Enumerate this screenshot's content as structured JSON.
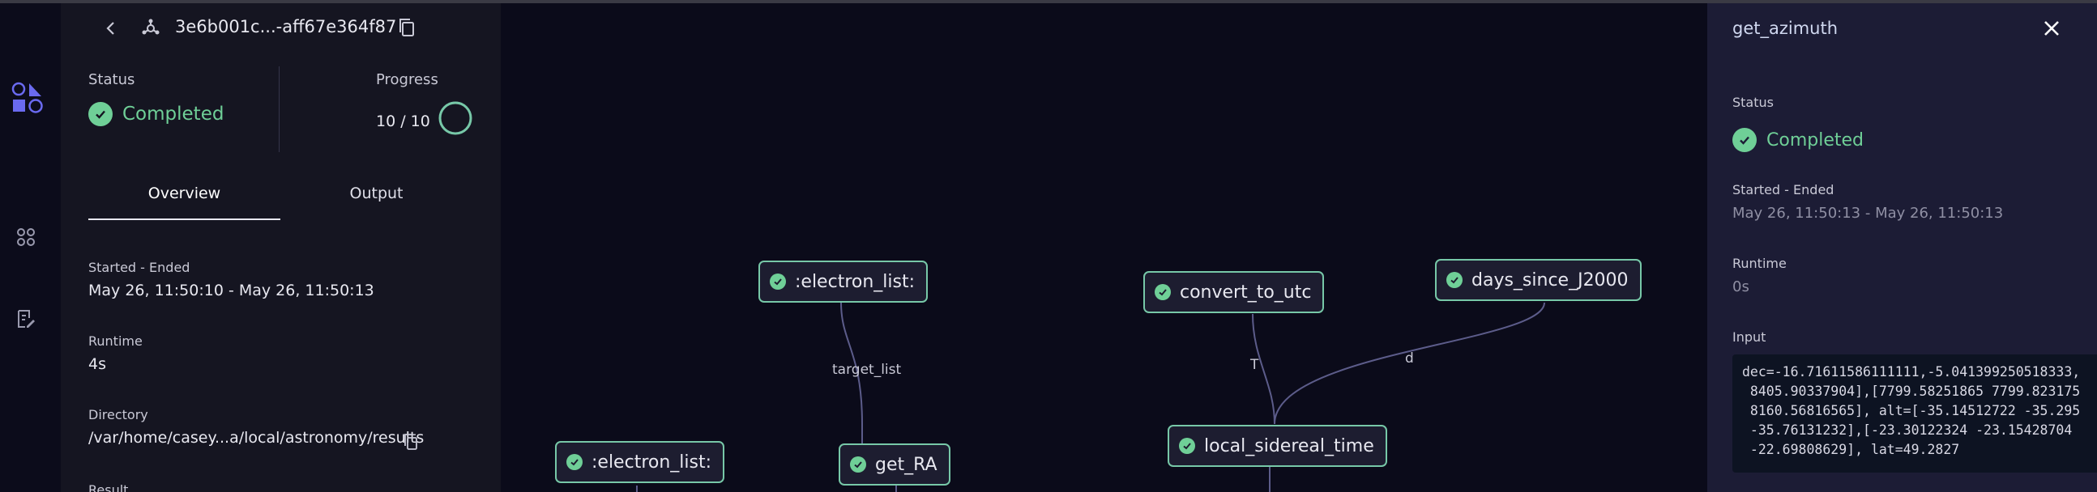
{
  "header": {
    "dispatch_id": "3e6b001c...-aff67e364f87"
  },
  "summary": {
    "status_label": "Status",
    "status_value": "Completed",
    "progress_label": "Progress",
    "progress_value": "10 / 10",
    "progress_fraction": 1.0
  },
  "tabs": [
    {
      "label": "Overview",
      "active": true
    },
    {
      "label": "Output",
      "active": false
    }
  ],
  "overview": {
    "started_ended_label": "Started - Ended",
    "started_ended_value": "May 26, 11:50:10 - May 26, 11:50:13",
    "runtime_label": "Runtime",
    "runtime_value": "4s",
    "directory_label": "Directory",
    "directory_value": "/var/home/casey...a/local/astronomy/results",
    "result_label": "Result"
  },
  "graph": {
    "nodes": [
      {
        "label": ":electron_list:"
      },
      {
        "label": "convert_to_utc"
      },
      {
        "label": "days_since_J2000"
      },
      {
        "label": "get_RA"
      },
      {
        "label": "local_sidereal_time"
      },
      {
        "label": ":electron_list:"
      }
    ],
    "edge_labels": [
      "target_list",
      "T",
      "d"
    ]
  },
  "detail": {
    "title": "get_azimuth",
    "status_label": "Status",
    "status_value": "Completed",
    "started_ended_label": "Started - Ended",
    "started_ended_value": "May 26, 11:50:13 - May 26, 11:50:13",
    "runtime_label": "Runtime",
    "runtime_value": "0s",
    "input_label": "Input",
    "input_lines": [
      "dec=-16.71611586111111,-5.041399250518333,",
      " 8405.90337904],[7799.58251865 7799.823175",
      " 8160.56816565], alt=[-35.14512722 -35.295",
      " -35.76131232],[-23.30122324 -23.15428704",
      " -22.69808629], lat=49.2827"
    ]
  },
  "colors": {
    "success": "#6fcf97",
    "node_border": "#77c8a8",
    "background": "#0b0b1a",
    "panel": "#151521",
    "detail_panel": "#1c1c35"
  },
  "icons": [
    "back-arrow-icon",
    "dispatch-icon",
    "copy-icon",
    "check-circle-icon",
    "progress-ring-icon",
    "covalent-logo-icon",
    "lattice-icon",
    "notes-icon",
    "close-icon"
  ]
}
